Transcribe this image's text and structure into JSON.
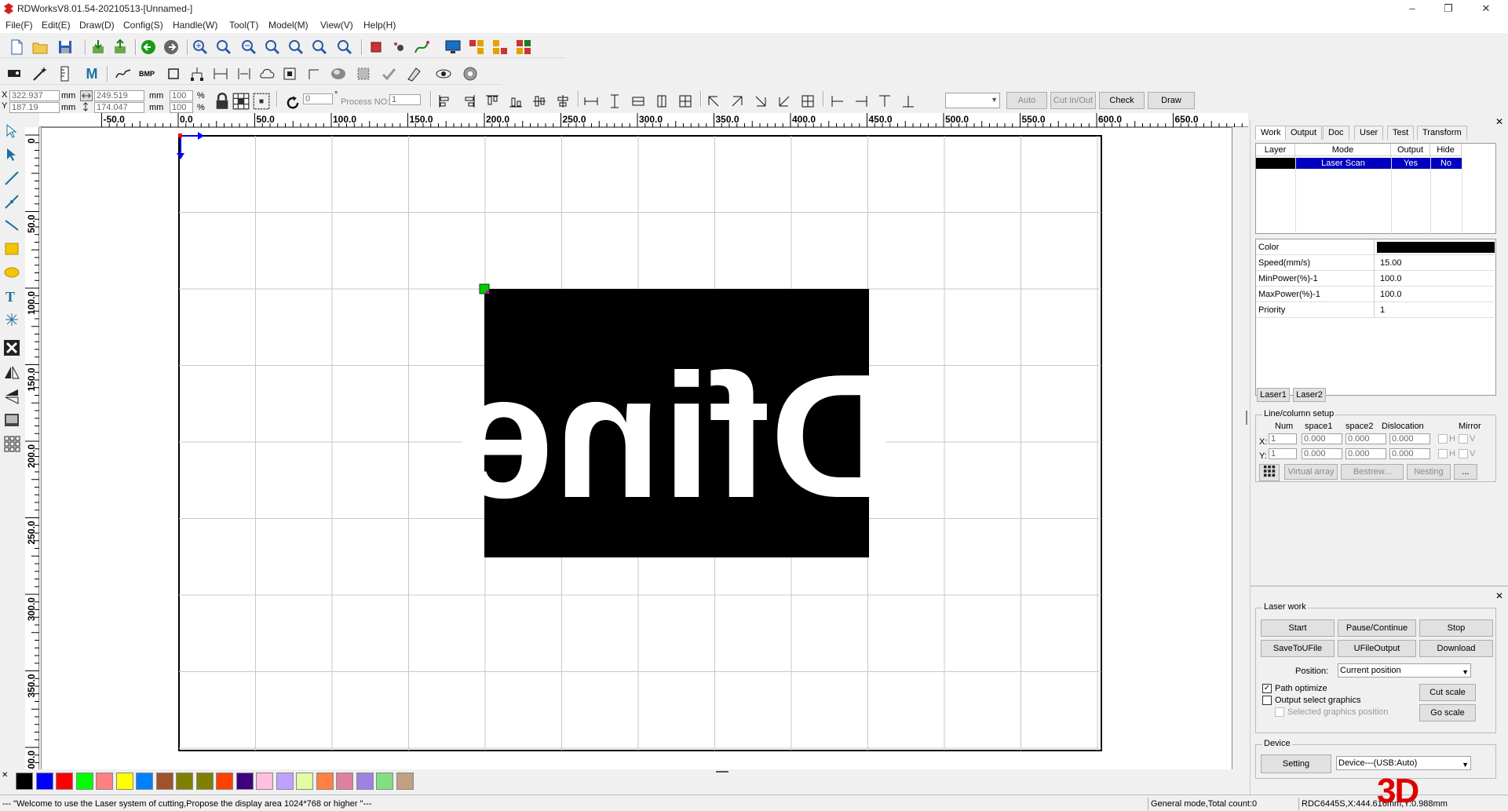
{
  "window": {
    "title": "RDWorksV8.01.54-20210513-[Unnamed-]",
    "minimize_label": "–",
    "restore_label": "❐",
    "close_label": "✕"
  },
  "menu": [
    "File(F)",
    "Edit(E)",
    "Draw(D)",
    "Config(S)",
    "Handle(W)",
    "Tool(T)",
    "Model(M)",
    "View(V)",
    "Help(H)"
  ],
  "toolbar3": {
    "bmp_label": "BMP",
    "m_label": "M"
  },
  "props": {
    "x_label": "X",
    "y_label": "Y",
    "x_value": "322.937",
    "y_value": "187.19",
    "w_value": "249.519",
    "h_value": "174.047",
    "unit_mm": "mm",
    "scale_x": "100",
    "scale_y": "100",
    "percent": "%",
    "rotate_value": "0",
    "degree": "°",
    "process_no_label": "Process NO:",
    "process_no_value": "1",
    "auto_label": "Auto",
    "cut_in_out_label": "Cut In/Out",
    "check_label": "Check",
    "draw_label": "Draw"
  },
  "ruler": {
    "h_ticks": [
      "-50.0",
      "0.0",
      "50.0",
      "100.0",
      "150.0",
      "200.0",
      "250.0",
      "300.0",
      "350.0",
      "400.0",
      "450.0",
      "500.0",
      "550.0",
      "600.0",
      "650.0"
    ],
    "v_ticks": [
      "0",
      "50.0",
      "100.0",
      "150.0",
      "200.0",
      "250.0",
      "300.0",
      "350.0",
      "400.0"
    ]
  },
  "canvas": {
    "artwork_text": "Dfine",
    "artwork_bg": "#000000",
    "artwork_fg": "#ffffff",
    "grid_color": "#c8c8c8",
    "origin_color": "#0000ff",
    "handle_color": "#00cc00"
  },
  "right_panel": {
    "tabs": [
      "Work",
      "Output",
      "Doc",
      "User",
      "Test",
      "Transform"
    ],
    "layer_table": {
      "headers": [
        "Layer",
        "Mode",
        "Output",
        "Hide"
      ],
      "rows": [
        {
          "layer_color": "#000000",
          "mode": "Laser Scan",
          "output": "Yes",
          "hide": "No"
        }
      ]
    },
    "properties": [
      {
        "label": "Color",
        "value": ""
      },
      {
        "label": "Speed(mm/s)",
        "value": "15.00"
      },
      {
        "label": "MinPower(%)-1",
        "value": "100.0"
      },
      {
        "label": "MaxPower(%)-1",
        "value": "100.0"
      },
      {
        "label": "Priority",
        "value": "1"
      }
    ],
    "laser_tabs": [
      "Laser1",
      "Laser2"
    ],
    "line_column": {
      "title": "Line/column setup",
      "headers": [
        "Num",
        "space1",
        "space2",
        "Dislocation",
        "Mirror"
      ],
      "x_label": "X:",
      "y_label": "Y:",
      "x_values": [
        "1",
        "0.000",
        "0.000",
        "0.000"
      ],
      "y_values": [
        "1",
        "0.000",
        "0.000",
        "0.000"
      ],
      "h_label": "H",
      "v_label": "V",
      "virtual_array": "Virtual array",
      "bestrew": "Bestrew...",
      "nesting": "Nesting",
      "more": "..."
    },
    "laser_work": {
      "title": "Laser work",
      "start": "Start",
      "pause_continue": "Pause/Continue",
      "stop": "Stop",
      "save_to_ufile": "SaveToUFile",
      "ufile_output": "UFileOutput",
      "download": "Download",
      "position_label": "Position:",
      "position_value": "Current position",
      "path_optimize": "Path optimize",
      "output_select": "Output select graphics",
      "selected_position": "Selected graphics position",
      "cut_scale": "Cut scale",
      "go_scale": "Go scale"
    },
    "device": {
      "title": "Device",
      "setting": "Setting",
      "device_value": "Device---(USB:Auto)"
    }
  },
  "palette": [
    "#000000",
    "#0000ff",
    "#ff0000",
    "#00ff00",
    "#ff8080",
    "#ffff00",
    "#0080ff",
    "#a0522d",
    "#808000",
    "#808000",
    "#ff4000",
    "#400080",
    "#ffc0e0",
    "#c0a0ff",
    "#e0ffa0",
    "#ff8040",
    "#e080a0",
    "#a080e0",
    "#80e080",
    "#c0a080"
  ],
  "status": {
    "welcome": "--- \"Welcome to use the Laser system of cutting,Propose the display area 1024*768 or higher \"---",
    "mode": "General mode,Total count:0",
    "device": "RDC6445S,X:444.616mm,Y:0.988mm"
  },
  "watermark": "3D"
}
